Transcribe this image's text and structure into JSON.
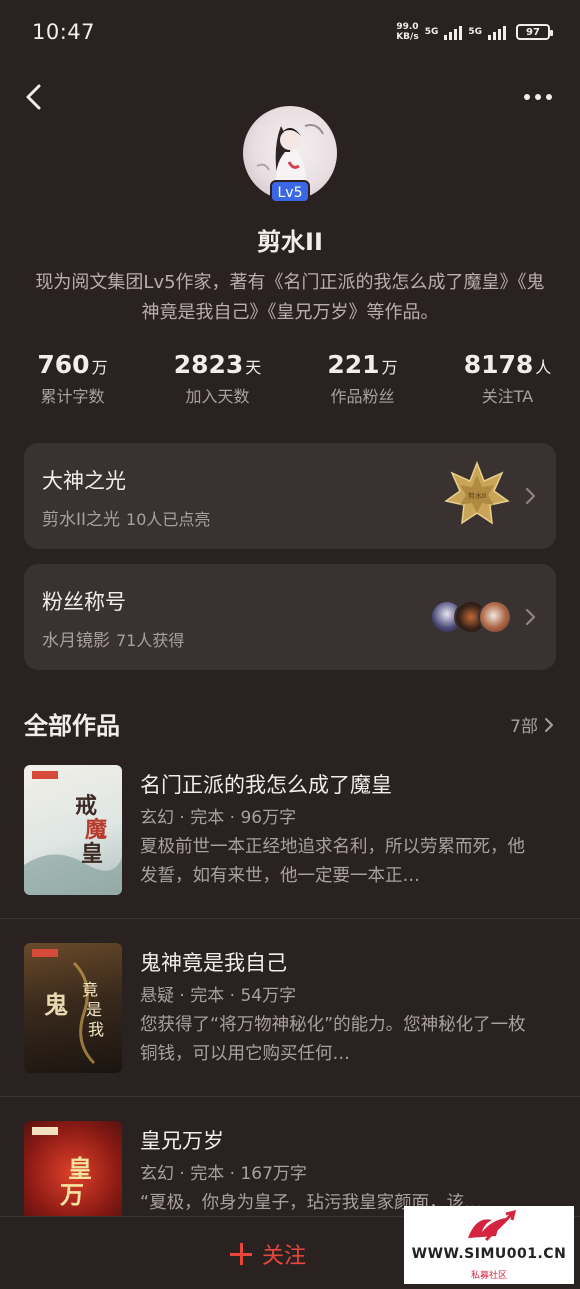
{
  "status_bar": {
    "time": "10:47",
    "net_speed_value": "99.0",
    "net_speed_unit": "KB/s",
    "net1": "5G",
    "net2": "5G",
    "battery": "97"
  },
  "profile": {
    "name": "剪水II",
    "level": "Lv5",
    "bio": "现为阅文集团Lv5作家，著有《名门正派的我怎么成了魔皇》《鬼神竟是我自己》《皇兄万岁》等作品。"
  },
  "stats": [
    {
      "value": "760",
      "unit": "万",
      "label": "累计字数"
    },
    {
      "value": "2823",
      "unit": "天",
      "label": "加入天数"
    },
    {
      "value": "221",
      "unit": "万",
      "label": "作品粉丝"
    },
    {
      "value": "8178",
      "unit": "人",
      "label": "关注TA"
    }
  ],
  "cards": {
    "glory": {
      "title": "大神之光",
      "subtitle": "剪水II之光",
      "count": "10人已点亮",
      "medal_text": "剪水II"
    },
    "fan_title": {
      "title": "粉丝称号",
      "subtitle": "水月镜影",
      "count": "71人获得"
    }
  },
  "works_section": {
    "title": "全部作品",
    "count": "7部"
  },
  "books": [
    {
      "title": "名门正派的我怎么成了魔皇",
      "genre": "玄幻",
      "status": "完本",
      "words": "96万字",
      "desc": "夏极前世一本正经地追求名利，所以劳累而死，他发誓，如有来世，他一定要一本正…",
      "cover_text": "戒魔皇"
    },
    {
      "title": "鬼神竟是我自己",
      "genre": "悬疑",
      "status": "完本",
      "words": "54万字",
      "desc": "您获得了“将万物神秘化”的能力。您神秘化了一枚铜钱，可以用它购买任何…",
      "cover_text": "竟是我自己"
    },
    {
      "title": "皇兄万岁",
      "genre": "玄幻",
      "status": "完本",
      "words": "167万字",
      "desc": "“夏极，你身为皇子，玷污我皇家颜面，该…",
      "cover_text": "皇兄万岁"
    }
  ],
  "bottom": {
    "follow_label": "关注"
  },
  "watermark": {
    "url": "WWW.SIMU001.CN",
    "name": "私募社区"
  }
}
